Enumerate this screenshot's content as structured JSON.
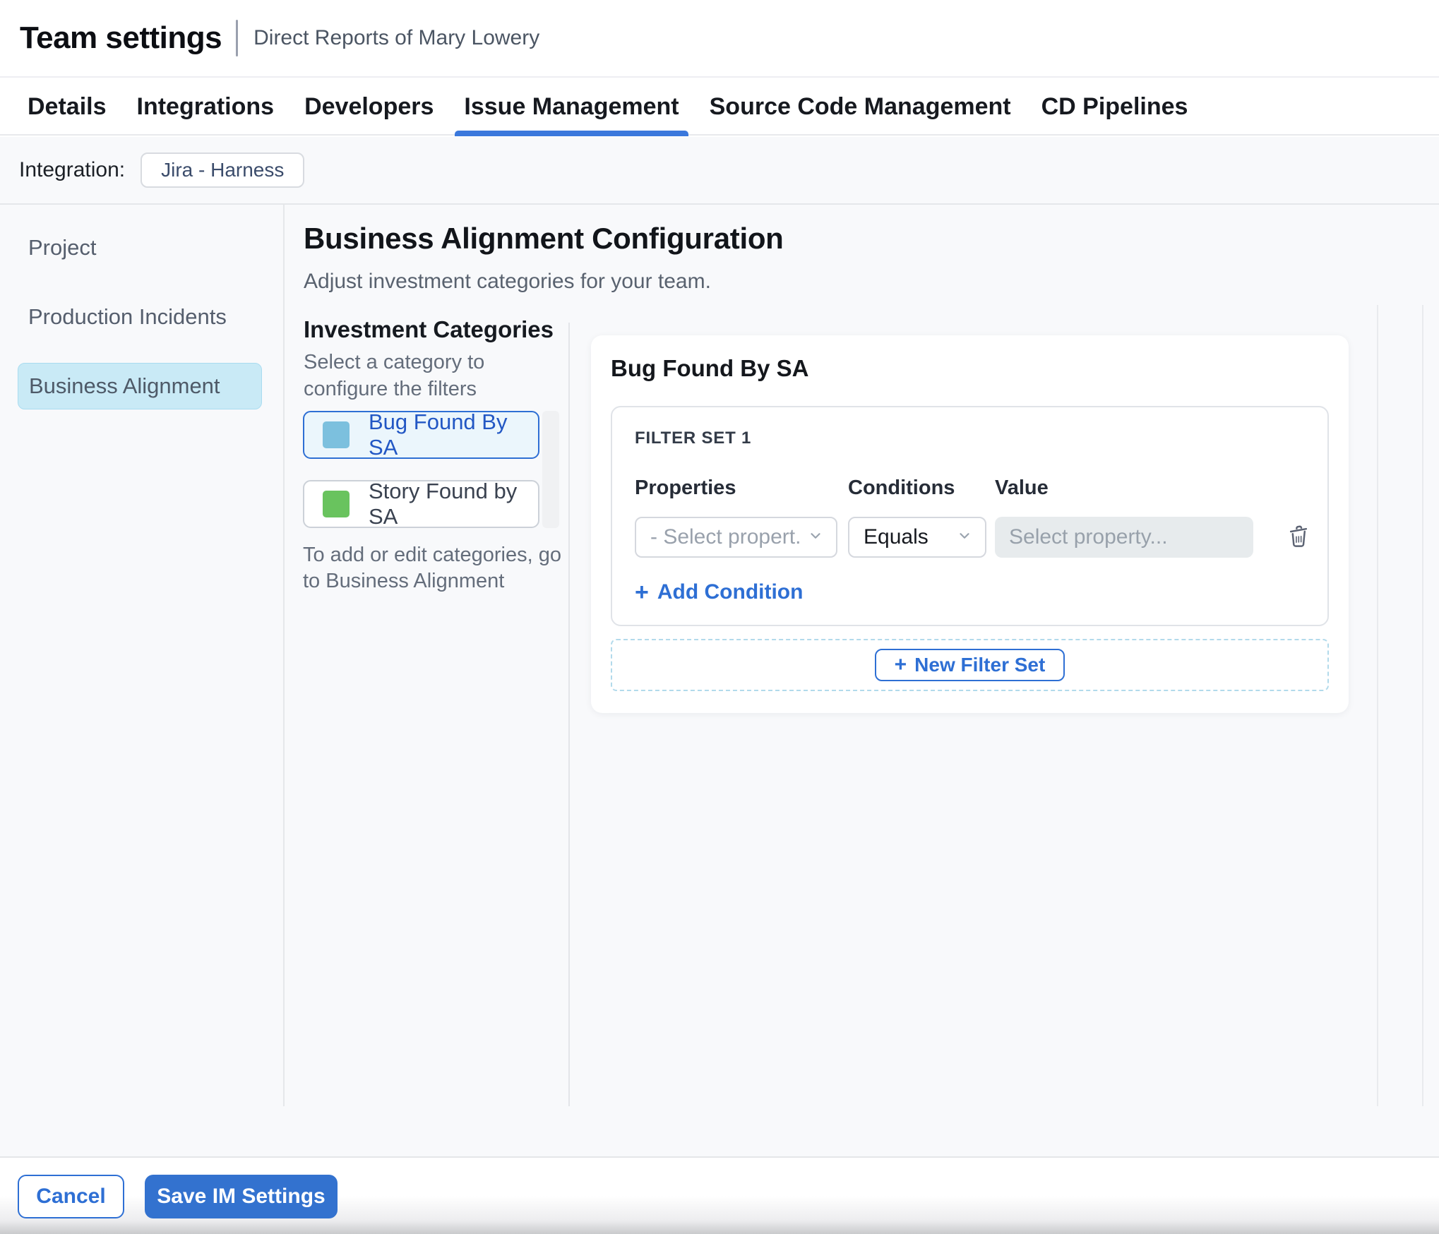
{
  "header": {
    "title": "Team settings",
    "subtitle": "Direct Reports of Mary Lowery"
  },
  "tabs": {
    "items": [
      {
        "label": "Details",
        "active": false
      },
      {
        "label": "Integrations",
        "active": false
      },
      {
        "label": "Developers",
        "active": false
      },
      {
        "label": "Issue Management",
        "active": true
      },
      {
        "label": "Source Code Management",
        "active": false
      },
      {
        "label": "CD Pipelines",
        "active": false
      }
    ]
  },
  "integration": {
    "label": "Integration:",
    "chip": "Jira - Harness"
  },
  "sidebar": {
    "items": [
      {
        "label": "Project",
        "selected": false
      },
      {
        "label": "Production Incidents",
        "selected": false
      },
      {
        "label": "Business Alignment",
        "selected": true
      }
    ]
  },
  "main": {
    "heading": "Business Alignment Configuration",
    "subheading": "Adjust investment categories for your team.",
    "categories": {
      "title": "Investment Categories",
      "description": "Select a category to configure the filters",
      "items": [
        {
          "label": "Bug Found By SA",
          "swatch_color": "#7cc0de",
          "selected": true
        },
        {
          "label": "Story Found by SA",
          "swatch_color": "#69c35e",
          "selected": false
        }
      ],
      "note": "To add or edit categories, go to Business Alignment"
    },
    "filter_panel": {
      "title": "Bug Found By SA",
      "filter_set": {
        "title": "FILTER SET 1",
        "columns": [
          "Properties",
          "Conditions",
          "Value"
        ],
        "row": {
          "property_placeholder": "- Select propert...",
          "condition_value": "Equals",
          "value_placeholder": "Select property..."
        },
        "add_condition_label": "Add Condition"
      },
      "new_filter_set_label": "New Filter Set"
    }
  },
  "footer": {
    "cancel_label": "Cancel",
    "save_label": "Save IM Settings"
  },
  "icons": {
    "plus": "+"
  },
  "colors": {
    "accent": "#2e6fd4",
    "save_bg": "#3372cf",
    "tab_underline": "#3b78dc",
    "selected_sidebar_bg": "#c9eaf6",
    "category_selected_bg": "#ebf6fc",
    "bug_swatch": "#7cc0de",
    "story_swatch": "#69c35e"
  }
}
